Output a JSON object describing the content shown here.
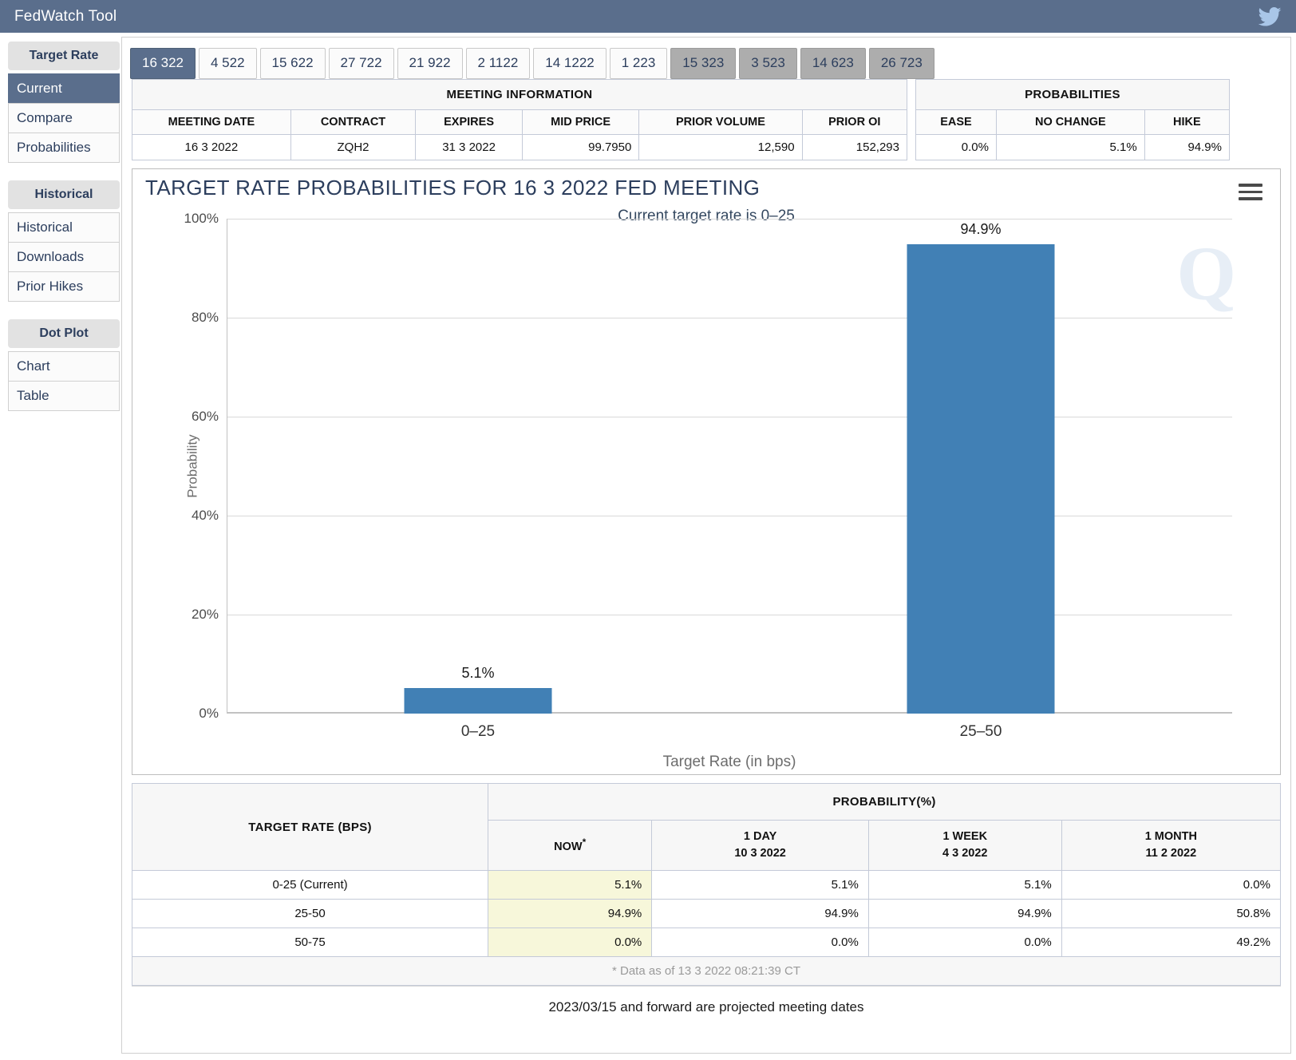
{
  "titlebar": {
    "title": "FedWatch Tool",
    "social_icon": "twitter-icon"
  },
  "sidebar": {
    "groups": [
      {
        "heading": "Target Rate",
        "items": [
          {
            "label": "Current",
            "active": true
          },
          {
            "label": "Compare",
            "active": false
          },
          {
            "label": "Probabilities",
            "active": false
          }
        ]
      },
      {
        "heading": "Historical",
        "items": [
          {
            "label": "Historical",
            "active": false
          },
          {
            "label": "Downloads",
            "active": false
          },
          {
            "label": "Prior Hikes",
            "active": false
          }
        ]
      },
      {
        "heading": "Dot Plot",
        "items": [
          {
            "label": "Chart",
            "active": false
          },
          {
            "label": "Table",
            "active": false
          }
        ]
      }
    ]
  },
  "tabs": [
    {
      "label": "16 322",
      "state": "active"
    },
    {
      "label": "4 522",
      "state": "normal"
    },
    {
      "label": "15 622",
      "state": "normal"
    },
    {
      "label": "27 722",
      "state": "normal"
    },
    {
      "label": "21 922",
      "state": "normal"
    },
    {
      "label": "2 1122",
      "state": "normal"
    },
    {
      "label": "14 1222",
      "state": "normal"
    },
    {
      "label": "1 223",
      "state": "normal"
    },
    {
      "label": "15 323",
      "state": "muted"
    },
    {
      "label": "3 523",
      "state": "muted"
    },
    {
      "label": "14 623",
      "state": "muted"
    },
    {
      "label": "26 723",
      "state": "muted"
    }
  ],
  "meeting_information": {
    "super_header": "MEETING INFORMATION",
    "columns": [
      "MEETING DATE",
      "CONTRACT",
      "EXPIRES",
      "MID PRICE",
      "PRIOR VOLUME",
      "PRIOR OI"
    ],
    "row": {
      "meeting_date": "16 3 2022",
      "contract": "ZQH2",
      "expires": "31 3 2022",
      "mid_price": "99.7950",
      "prior_volume": "12,590",
      "prior_oi": "152,293"
    }
  },
  "probabilities_summary": {
    "super_header": "PROBABILITIES",
    "columns": [
      "EASE",
      "NO CHANGE",
      "HIKE"
    ],
    "row": {
      "ease": "0.0%",
      "no_change": "5.1%",
      "hike": "94.9%"
    }
  },
  "chart_header": {
    "title": "TARGET RATE PROBABILITIES FOR 16 3 2022 FED MEETING",
    "subtitle": "Current target rate is 0–25",
    "menu_icon": "hamburger-menu-icon",
    "watermark": "Q"
  },
  "chart_data": {
    "type": "bar",
    "title": "TARGET RATE PROBABILITIES FOR 16 3 2022 FED MEETING",
    "subtitle": "Current target rate is 0–25",
    "categories": [
      "0–25",
      "25–50"
    ],
    "values": [
      5.1,
      94.9
    ],
    "value_labels": [
      "5.1%",
      "94.9%"
    ],
    "xlabel": "Target Rate (in bps)",
    "ylabel": "Probability",
    "ylim": [
      0,
      100
    ],
    "yticks": [
      0,
      20,
      40,
      60,
      80,
      100
    ],
    "ytick_labels": [
      "0%",
      "20%",
      "40%",
      "60%",
      "80%",
      "100%"
    ],
    "grid": true,
    "legend": "none",
    "bar_color": "#4180b5"
  },
  "probability_table": {
    "row_header": "TARGET RATE (BPS)",
    "span_header": "PROBABILITY(%)",
    "columns": [
      {
        "name": "NOW",
        "sub": "",
        "marker": "*"
      },
      {
        "name": "1 DAY",
        "sub": "10 3 2022",
        "marker": ""
      },
      {
        "name": "1 WEEK",
        "sub": "4 3 2022",
        "marker": ""
      },
      {
        "name": "1 MONTH",
        "sub": "11 2 2022",
        "marker": ""
      }
    ],
    "rows": [
      {
        "rate": "0-25 (Current)",
        "now": "5.1%",
        "day": "5.1%",
        "week": "5.1%",
        "month": "0.0%"
      },
      {
        "rate": "25-50",
        "now": "94.9%",
        "day": "94.9%",
        "week": "94.9%",
        "month": "50.8%"
      },
      {
        "rate": "50-75",
        "now": "0.0%",
        "day": "0.0%",
        "week": "0.0%",
        "month": "49.2%"
      }
    ],
    "footnote": "* Data as of 13 3 2022 08:21:39 CT"
  },
  "projected_note": "2023/03/15 and forward are projected meeting dates",
  "colors": {
    "header_blue": "#5a6e8c",
    "bar_blue": "#4180b5",
    "now_highlight": "#f7f7da",
    "title_text": "#2c3e5d"
  }
}
